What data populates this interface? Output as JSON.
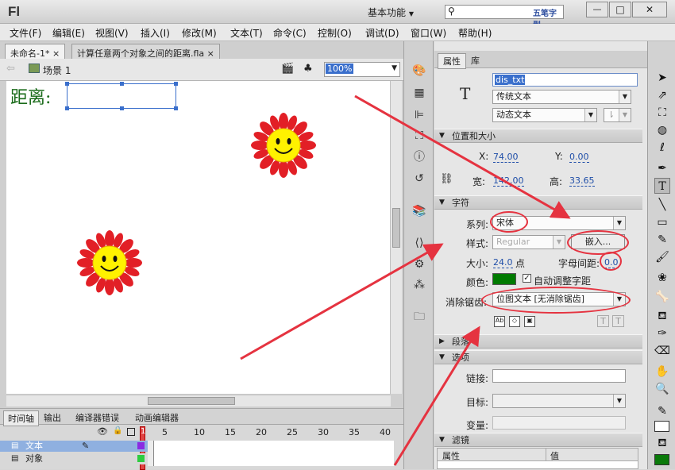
{
  "app": {
    "logo": "Fl",
    "workspace": "基本功能",
    "search_placeholder": "",
    "watermark": "五笔字型"
  },
  "window_controls": {
    "minimize": "—",
    "maximize": "□",
    "close": "✕"
  },
  "menu": [
    "文件(F)",
    "编辑(E)",
    "视图(V)",
    "插入(I)",
    "修改(M)",
    "文本(T)",
    "命令(C)",
    "控制(O)",
    "调试(D)",
    "窗口(W)",
    "帮助(H)"
  ],
  "doc_tabs": [
    {
      "label": "未命名-1*",
      "close": "×"
    },
    {
      "label": "计算任意两个对象之间的距离.fla",
      "close": "×"
    }
  ],
  "editbar": {
    "scene": "场景 1",
    "zoom": "100%"
  },
  "stage": {
    "label_text": "距离:"
  },
  "timeline": {
    "tabs": [
      "时间轴",
      "输出",
      "编译器错误",
      "动画编辑器"
    ],
    "frame_numbers": [
      "1",
      "5",
      "10",
      "15",
      "20",
      "25",
      "30",
      "35",
      "40"
    ],
    "layers": [
      {
        "name": "文本",
        "selected": true
      },
      {
        "name": "对象",
        "selected": false
      }
    ]
  },
  "properties": {
    "tabs": [
      "属性",
      "库"
    ],
    "instance_name": "dis_txt",
    "text_engine": "传统文本",
    "text_type": "动态文本",
    "sections": {
      "position": "位置和大小",
      "character": "字符",
      "paragraph": "段落",
      "options": "选项",
      "filters": "滤镜"
    },
    "position": {
      "x_label": "X:",
      "x": "74.00",
      "y_label": "Y:",
      "y": "0.00",
      "w_label": "宽:",
      "w": "142.00",
      "h_label": "高:",
      "h": "33.65"
    },
    "character": {
      "family_label": "系列:",
      "family": "宋体",
      "style_label": "样式:",
      "style": "Regular",
      "embed_button": "嵌入...",
      "size_label": "大小:",
      "size": "24.0",
      "size_unit": "点",
      "spacing_label": "字母间距:",
      "spacing": "0.0",
      "color_label": "颜色:",
      "color": "#007a00",
      "autokern": "自动调整字距",
      "antialias_label": "消除锯齿:",
      "antialias": "位图文本 [无消除锯齿]"
    },
    "options": {
      "link_label": "链接:",
      "target_label": "目标:",
      "var_label": "变量:"
    },
    "filters": {
      "col_prop": "属性",
      "col_val": "值"
    }
  },
  "colors": {
    "accent_red": "#e53340",
    "sun_petal": "#e21f26",
    "sun_face": "#fff200",
    "selected_blue": "#4a78c8"
  }
}
